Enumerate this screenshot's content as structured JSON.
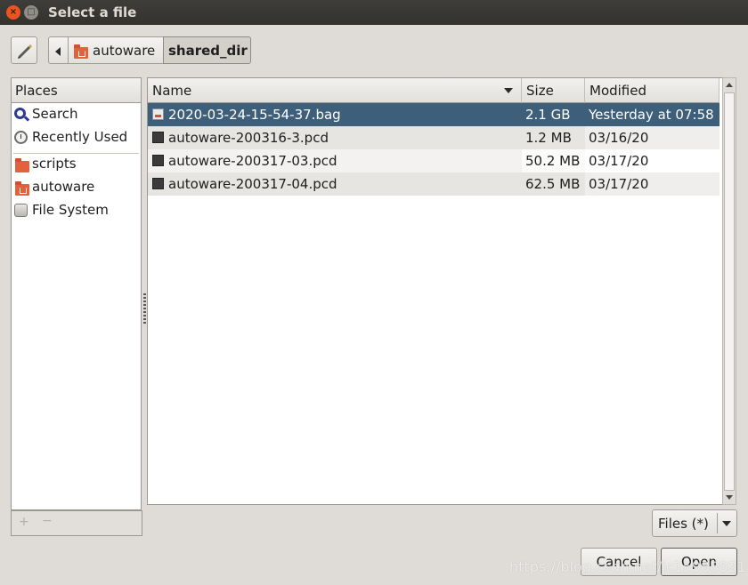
{
  "window": {
    "title": "Select a file"
  },
  "toolbar": {
    "edit_icon": "pencil-icon"
  },
  "path_bar": {
    "segments": [
      "autoware",
      "shared_dir"
    ]
  },
  "places": {
    "header": "Places",
    "items": [
      {
        "label": "Search",
        "icon": "search-icon"
      },
      {
        "label": "Recently Used",
        "icon": "clock-icon"
      },
      {
        "label": "scripts",
        "icon": "folder-icon"
      },
      {
        "label": "autoware",
        "icon": "home-folder-icon"
      },
      {
        "label": "File System",
        "icon": "disk-icon"
      }
    ],
    "add_symbol": "+",
    "remove_symbol": "−"
  },
  "file_list": {
    "columns": {
      "name": "Name",
      "size": "Size",
      "modified": "Modified"
    },
    "rows": [
      {
        "name": "2020-03-24-15-54-37.bag",
        "size": "2.1 GB",
        "modified": "Yesterday at 07:58",
        "selected": true
      },
      {
        "name": "autoware-200316-3.pcd",
        "size": "1.2 MB",
        "modified": "03/16/20"
      },
      {
        "name": "autoware-200317-03.pcd",
        "size": "50.2 MB",
        "modified": "03/17/20"
      },
      {
        "name": "autoware-200317-04.pcd",
        "size": "62.5 MB",
        "modified": "03/17/20"
      }
    ]
  },
  "filter": {
    "label": "Files (*)"
  },
  "buttons": {
    "cancel": "Cancel",
    "open": "Open"
  },
  "watermark": "https://blog.csdn.net/jc15988821760",
  "colors": {
    "selection": "#3e5f7a",
    "close_button": "#e95420",
    "titlebar": "#3b3a36"
  }
}
